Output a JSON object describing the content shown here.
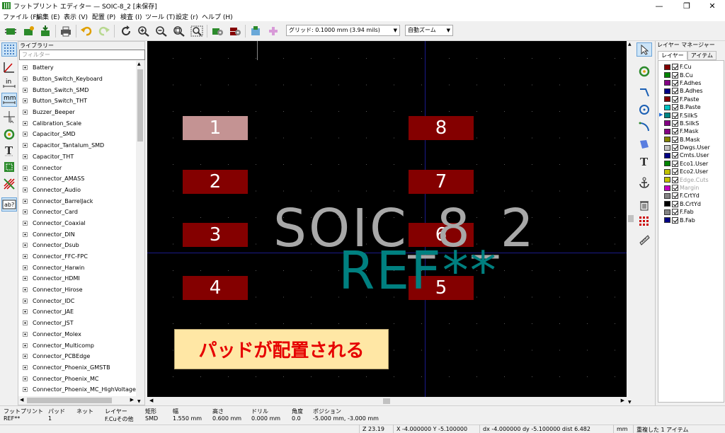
{
  "window": {
    "title": "フットプリント エディター — SOIC-8_2 [未保存]",
    "minimize": "—",
    "maximize": "❐",
    "close": "✕"
  },
  "menu": [
    "ファイル (F)",
    "編集 (E)",
    "表示 (V)",
    "配置 (P)",
    "検査 (I)",
    "ツール (T)",
    "設定 (r)",
    "ヘルプ (H)"
  ],
  "toolbar": {
    "grid_label": "グリッド: 0.1000 mm (3.94 mils)",
    "zoom_label": "自動ズーム"
  },
  "library": {
    "header": "ライブラリー",
    "filter_placeholder": "フィルター",
    "items": [
      "Battery",
      "Button_Switch_Keyboard",
      "Button_Switch_SMD",
      "Button_Switch_THT",
      "Buzzer_Beeper",
      "Calibration_Scale",
      "Capacitor_SMD",
      "Capacitor_Tantalum_SMD",
      "Capacitor_THT",
      "Connector",
      "Connector_AMASS",
      "Connector_Audio",
      "Connector_BarrelJack",
      "Connector_Card",
      "Connector_Coaxial",
      "Connector_DIN",
      "Connector_Dsub",
      "Connector_FFC-FPC",
      "Connector_Harwin",
      "Connector_HDMI",
      "Connector_Hirose",
      "Connector_IDC",
      "Connector_JAE",
      "Connector_JST",
      "Connector_Molex",
      "Connector_Multicomp",
      "Connector_PCBEdge",
      "Connector_Phoenix_GMSTB",
      "Connector_Phoenix_MC",
      "Connector_Phoenix_MC_HighVoltage"
    ]
  },
  "canvas": {
    "pads": [
      "1",
      "2",
      "3",
      "4",
      "5",
      "6",
      "7",
      "8"
    ],
    "footprint_value": "SOIC_8_2",
    "reference": "REF**",
    "callout": "パッドが配置される"
  },
  "layers": {
    "header": "レイヤー マネージャー",
    "tab_layers": "レイヤー",
    "tab_items": "アイテム",
    "items": [
      {
        "name": "F.Cu",
        "color": "#840000"
      },
      {
        "name": "B.Cu",
        "color": "#008400"
      },
      {
        "name": "F.Adhes",
        "color": "#840084"
      },
      {
        "name": "B.Adhes",
        "color": "#000084"
      },
      {
        "name": "F.Paste",
        "color": "#840000"
      },
      {
        "name": "B.Paste",
        "color": "#00c2c2"
      },
      {
        "name": "F.SilkS",
        "color": "#008484"
      },
      {
        "name": "B.SilkS",
        "color": "#840084"
      },
      {
        "name": "F.Mask",
        "color": "#840084"
      },
      {
        "name": "B.Mask",
        "color": "#848400"
      },
      {
        "name": "Dwgs.User",
        "color": "#c2c2c2"
      },
      {
        "name": "Cmts.User",
        "color": "#000084"
      },
      {
        "name": "Eco1.User",
        "color": "#008400"
      },
      {
        "name": "Eco2.User",
        "color": "#c2c200"
      },
      {
        "name": "Edge.Cuts",
        "color": "#c2c200"
      },
      {
        "name": "Margin",
        "color": "#c200c2"
      },
      {
        "name": "F.CrtYd",
        "color": "#848484"
      },
      {
        "name": "B.CrtYd",
        "color": "#000000"
      },
      {
        "name": "F.Fab",
        "color": "#848484"
      },
      {
        "name": "B.Fab",
        "color": "#000084"
      }
    ]
  },
  "status": {
    "headers": [
      "フットプリント",
      "パッド",
      "ネット",
      "レイヤー",
      "矩形",
      "幅",
      "高さ",
      "ドリル",
      "角度",
      "ポジション"
    ],
    "values": [
      "REF**",
      "1",
      "",
      "F.Cuその他",
      "SMD",
      "1.550 mm",
      "0.600 mm",
      "0.000 mm",
      "0.0",
      "-5.000 mm, -3.000 mm"
    ],
    "zoom": "Z 23.19",
    "xy": "X -4.000000  Y -5.100000",
    "delta": "dx -4.000000  dy -5.100000  dist 6.482",
    "units": "mm",
    "message": "重複した 1 アイテム"
  }
}
